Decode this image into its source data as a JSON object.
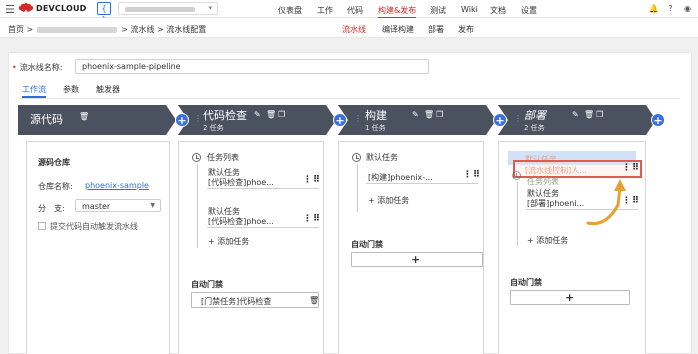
{
  "topbar": {
    "logo_text": "DEVCLOUD",
    "project_icon": "{ }",
    "nav": [
      "仪表盘",
      "工作",
      "代码",
      "构建&发布",
      "测试",
      "Wiki",
      "文档",
      "设置"
    ],
    "active_nav": "构建&发布",
    "icons": [
      "bell-icon",
      "help-icon",
      "user-icon"
    ]
  },
  "subbar": {
    "breadcrumb_home": "首页 >",
    "breadcrumb_rest": "> 流水线 > 流水线配置",
    "subnav": [
      "流水线",
      "编译构建",
      "部署",
      "发布"
    ],
    "active_subnav": "流水线"
  },
  "pipeline": {
    "name_label": "流水线名称:",
    "name_value": "phoenix-sample-pipeline",
    "tabs": [
      "工作流",
      "参数",
      "触发器"
    ],
    "active_tab": "工作流"
  },
  "stages": {
    "source": {
      "title": "源代码",
      "repo_title": "源码仓库",
      "repo_label": "仓库名称:",
      "repo_value": "phoenix-sample",
      "branch_label": "分　支:",
      "branch_value": "master",
      "trigger_label": "提交代码自动触发流水线"
    },
    "check": {
      "title": "代码检查",
      "count": "2 任务",
      "list_title": "任务列表",
      "task1_name": "默认任务",
      "task1_detail": "[代码检查]phoe...",
      "task2_name": "默认任务",
      "task2_detail": "[代码检查]phoe...",
      "add_task": "+ 添加任务",
      "gate_title": "自动门禁",
      "gate_item": "[门禁任务]代码检查"
    },
    "build": {
      "title": "构建",
      "count": "1 任务",
      "list_title": "默认任务",
      "task1_detail": "[构建]phoenix-...",
      "add_task": "+ 添加任务",
      "gate_title": "自动门禁",
      "gate_add": "+"
    },
    "deploy": {
      "title": "部署",
      "count": "2 任务",
      "drag_name": "默认任务",
      "drag_detail": "[流水线控制]人...",
      "list_title": "任务列表",
      "task_name": "默认任务",
      "task_detail": "[部署]phoeni...",
      "add_task": "+ 添加任务",
      "gate_title": "自动门禁",
      "gate_add": "+"
    }
  },
  "colors": {
    "accent": "#d22b2b",
    "link": "#2a6fdb",
    "stage_header": "#4a5260",
    "add_button": "#3a6fe0",
    "drag_arrow": "#e8a030"
  }
}
